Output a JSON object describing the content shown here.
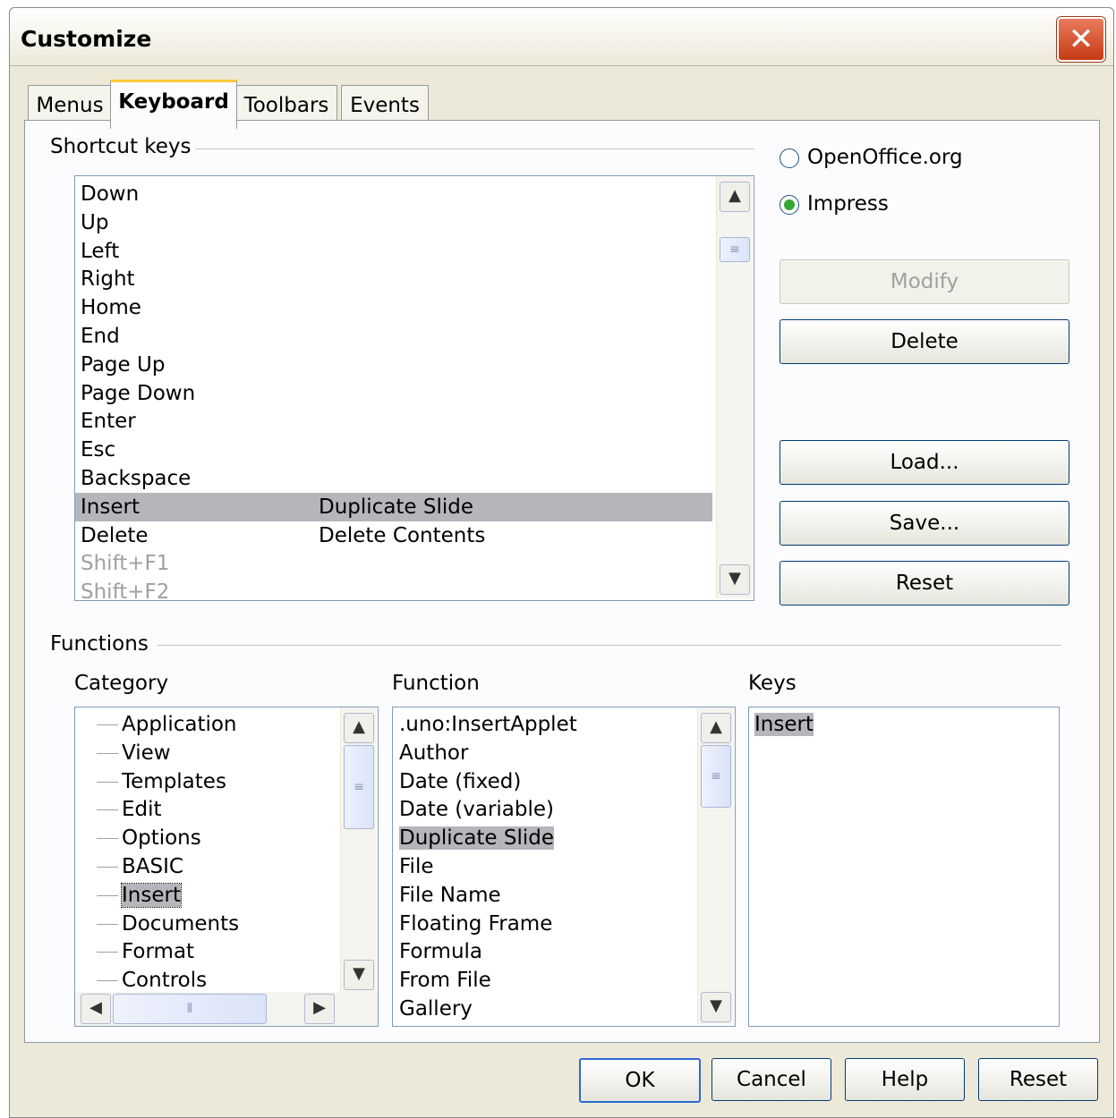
{
  "window": {
    "title": "Customize",
    "close_symbol": "✕"
  },
  "tabs": [
    {
      "label": "Menus",
      "active": false
    },
    {
      "label": "Keyboard",
      "active": true
    },
    {
      "label": "Toolbars",
      "active": false
    },
    {
      "label": "Events",
      "active": false
    }
  ],
  "shortcut_keys": {
    "label": "Shortcut keys",
    "rows": [
      {
        "key": "Down",
        "function": ""
      },
      {
        "key": "Up",
        "function": ""
      },
      {
        "key": "Left",
        "function": ""
      },
      {
        "key": "Right",
        "function": ""
      },
      {
        "key": "Home",
        "function": ""
      },
      {
        "key": "End",
        "function": ""
      },
      {
        "key": "Page Up",
        "function": ""
      },
      {
        "key": "Page Down",
        "function": ""
      },
      {
        "key": "Enter",
        "function": ""
      },
      {
        "key": "Esc",
        "function": ""
      },
      {
        "key": "Backspace",
        "function": ""
      },
      {
        "key": "Insert",
        "function": "Duplicate Slide",
        "selected": true
      },
      {
        "key": "Delete",
        "function": "Delete Contents"
      },
      {
        "key": "Shift+F1",
        "function": "",
        "disabled": true
      },
      {
        "key": "Shift+F2",
        "function": "",
        "disabled": true
      }
    ]
  },
  "scope": {
    "options": [
      {
        "label": "OpenOffice.org",
        "selected": false
      },
      {
        "label": "Impress",
        "selected": true
      }
    ]
  },
  "side_buttons": {
    "modify": "Modify",
    "delete": "Delete",
    "load": "Load...",
    "save": "Save...",
    "reset": "Reset"
  },
  "functions": {
    "label": "Functions",
    "category_label": "Category",
    "function_label": "Function",
    "keys_label": "Keys",
    "categories": [
      "Application",
      "View",
      "Templates",
      "Edit",
      "Options",
      "BASIC",
      "Insert",
      "Documents",
      "Format",
      "Controls"
    ],
    "selected_category": "Insert",
    "function_items": [
      ".uno:InsertApplet",
      "Author",
      "Date (fixed)",
      "Date (variable)",
      "Duplicate Slide",
      "File",
      "File Name",
      "Floating Frame",
      "Formula",
      "From File",
      "Gallery"
    ],
    "selected_function": "Duplicate Slide",
    "keys": [
      "Insert"
    ]
  },
  "footer": {
    "ok": "OK",
    "cancel": "Cancel",
    "help": "Help",
    "reset": "Reset"
  },
  "colors": {
    "selection": "#b5b5bc",
    "dialog_bg": "#ece9d8",
    "button_border": "#003c74",
    "active_tab_accent": "#ffc83c"
  }
}
